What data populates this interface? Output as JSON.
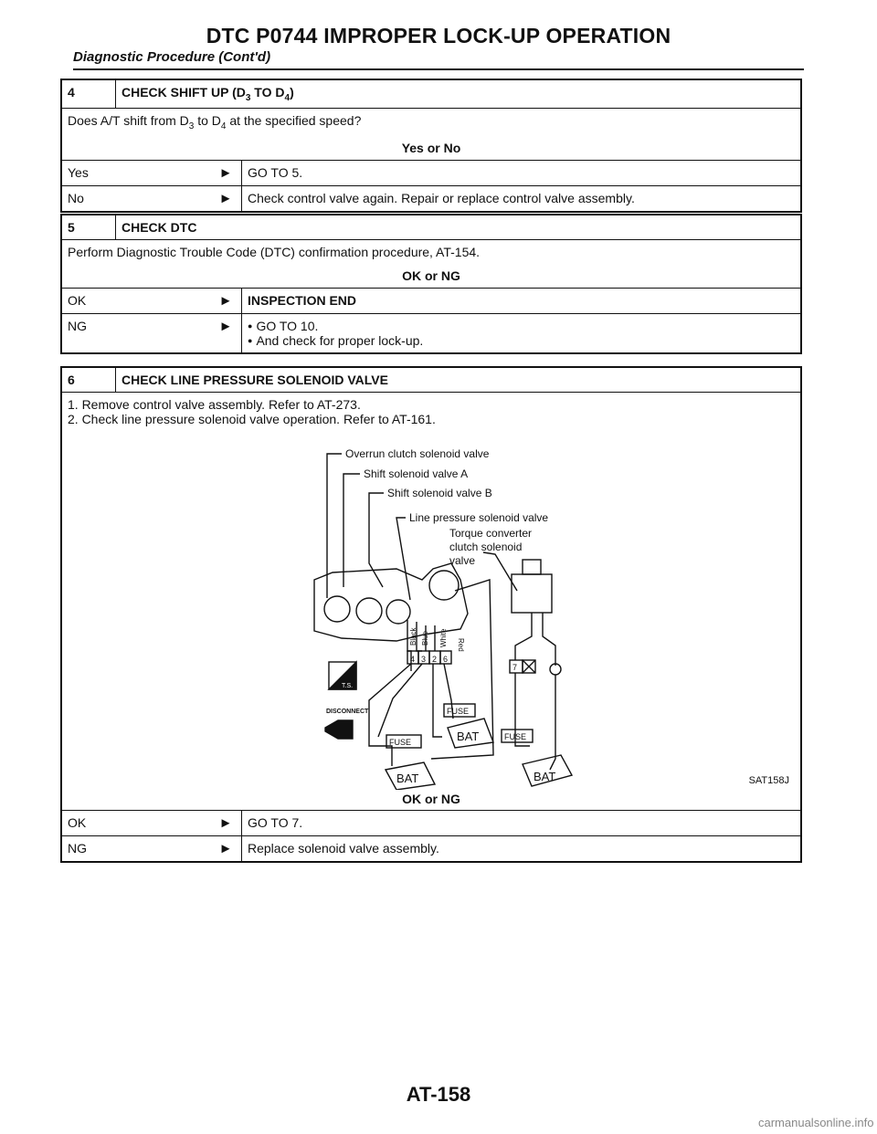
{
  "header": {
    "title": "DTC P0744 IMPROPER LOCK-UP OPERATION",
    "subtitle": "Diagnostic Procedure (Cont'd)"
  },
  "step4": {
    "number": "4",
    "title_pre": "CHECK SHIFT UP (D",
    "title_sub1": "3",
    "title_mid": " TO D",
    "title_sub2": "4",
    "title_post": ")",
    "q_pre": "Does A/T shift from D",
    "q_sub1": "3",
    "q_mid": " to D",
    "q_sub2": "4",
    "q_post": " at the specified speed?",
    "prompt": "Yes or No",
    "rows": [
      {
        "label": "Yes",
        "arrow": "►",
        "action": "GO TO 5."
      },
      {
        "label": "No",
        "arrow": "►",
        "action": "Check control valve again. Repair or replace control valve assembly."
      }
    ]
  },
  "step5": {
    "number": "5",
    "title": "CHECK DTC",
    "body": "Perform Diagnostic Trouble Code (DTC) confirmation procedure, AT-154.",
    "prompt": "OK or NG",
    "ok_label": "OK",
    "ok_arrow": "►",
    "ok_action": "INSPECTION END",
    "ng_label": "NG",
    "ng_arrow": "►",
    "ng_items": [
      "GO TO 10.",
      "And check for proper lock-up."
    ]
  },
  "step6": {
    "number": "6",
    "title": "CHECK LINE PRESSURE SOLENOID VALVE",
    "line1": "1. Remove control valve assembly. Refer to AT-273.",
    "line2": "2. Check line pressure solenoid valve operation. Refer to AT-161.",
    "figure": {
      "labels": {
        "overrun": "Overrun clutch solenoid valve",
        "shift_a": "Shift solenoid valve A",
        "shift_b": "Shift solenoid valve B",
        "line_pressure": "Line pressure solenoid valve",
        "tcc1": "Torque converter",
        "tcc2": "clutch solenoid",
        "tcc3": "valve",
        "fuse": "FUSE",
        "bat": "BAT",
        "disconnect": "DISCONNECT",
        "ts": "T.S.",
        "wire_black": "Black",
        "wire_blue": "Blue",
        "wire_white": "White",
        "wire_red": "Red",
        "pin4": "4",
        "pin3": "3",
        "pin2": "2",
        "pin6": "6",
        "pin7": "7"
      },
      "code": "SAT158J"
    },
    "prompt": "OK or NG",
    "rows": [
      {
        "label": "OK",
        "arrow": "►",
        "action": "GO TO 7."
      },
      {
        "label": "NG",
        "arrow": "►",
        "action": "Replace solenoid valve assembly."
      }
    ]
  },
  "footer": {
    "page": "AT-158",
    "watermark": "carmanualsonline.info"
  }
}
